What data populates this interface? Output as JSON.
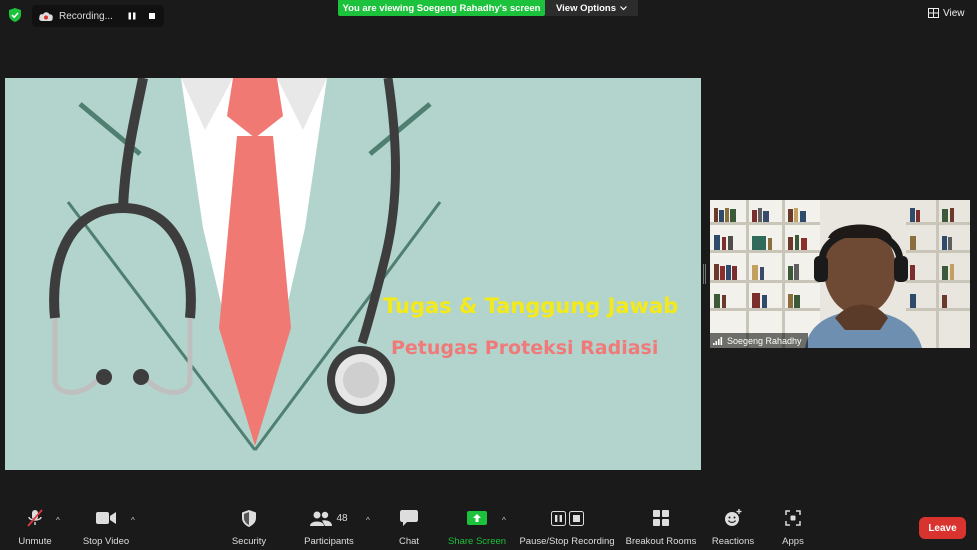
{
  "recording": {
    "label": "Recording..."
  },
  "banner": {
    "viewing": "You are viewing Soegeng Rahadhy's screen",
    "view_options": "View Options"
  },
  "view_button": "View",
  "slide": {
    "title1": "Tugas & Tanggung Jawab",
    "title2": "Petugas Proteksi Radiasi"
  },
  "participant": {
    "name": "Soegeng Rahadhy"
  },
  "toolbar": {
    "unmute": "Unmute",
    "stop_video": "Stop Video",
    "security": "Security",
    "participants": "Participants",
    "participants_count": "48",
    "chat": "Chat",
    "share_screen": "Share Screen",
    "pause_stop_recording": "Pause/Stop Recording",
    "breakout_rooms": "Breakout Rooms",
    "reactions": "Reactions",
    "apps": "Apps",
    "leave": "Leave"
  },
  "colors": {
    "green": "#1cc13c",
    "leave": "#d8332f",
    "slide_bg": "#b2d4cc"
  }
}
